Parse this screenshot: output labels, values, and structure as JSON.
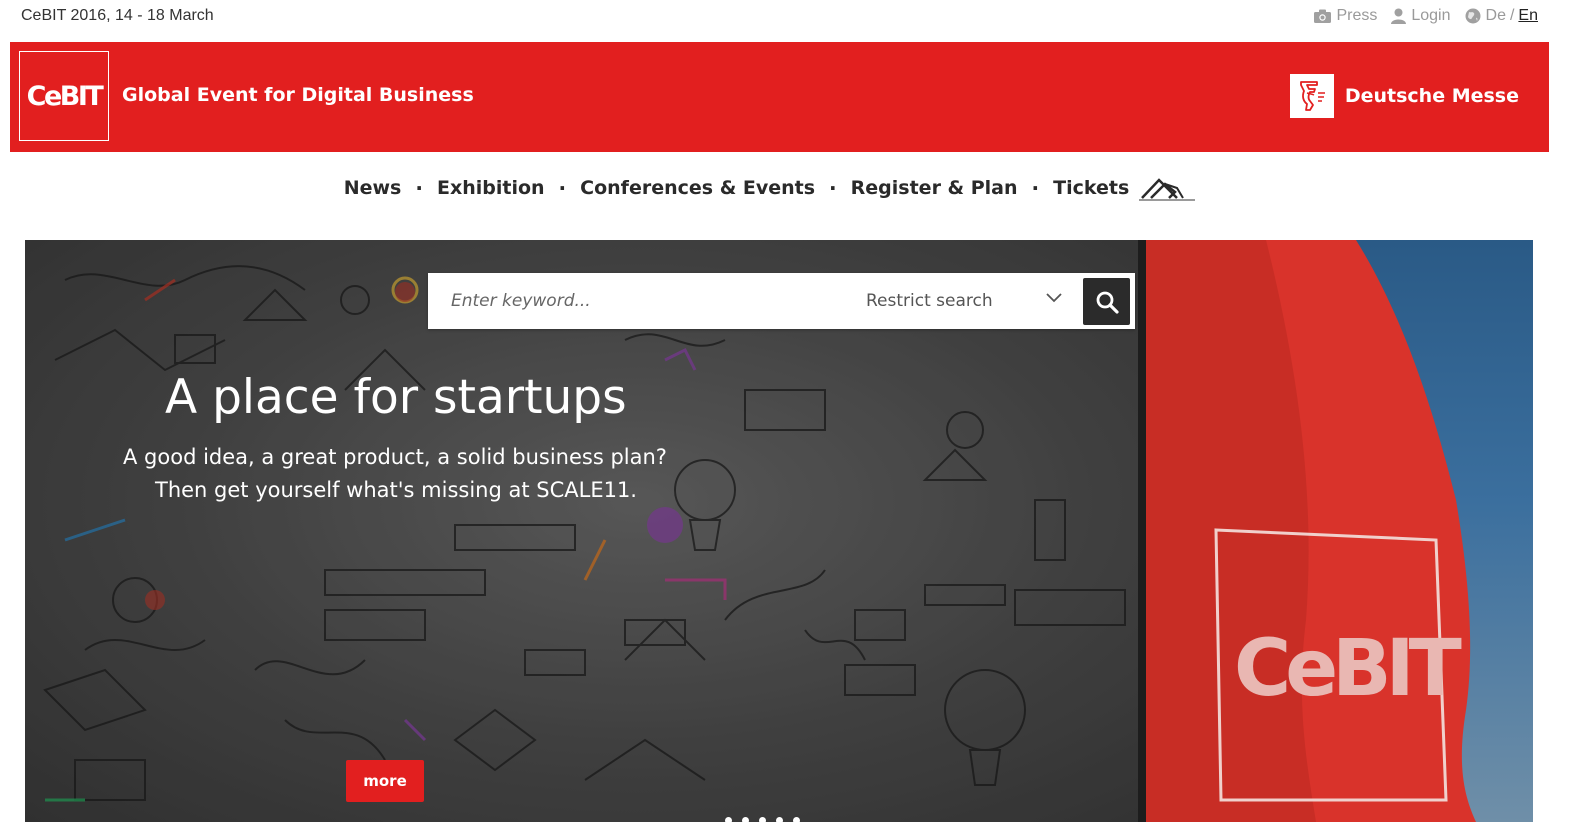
{
  "topbar": {
    "date": "CeBIT 2016, 14 - 18 March",
    "press_label": "Press",
    "login_label": "Login",
    "lang_de": "De",
    "lang_separator": "/",
    "lang_en": "En",
    "press_icon": "camera-icon",
    "login_icon": "user-icon",
    "lang_icon": "globe-icon"
  },
  "brand": {
    "logo_text": "CeBIT",
    "tagline": "Global Event for Digital Business",
    "partner_name": "Deutsche Messe",
    "partner_icon": "deutsche-messe-logo-icon",
    "brand_color": "#e21f1f"
  },
  "nav": {
    "items": [
      "News",
      "Exhibition",
      "Conferences & Events",
      "Register & Plan",
      "Tickets"
    ],
    "separator": "·",
    "ticket_icon": "ticket-icon"
  },
  "search": {
    "placeholder": "Enter keyword...",
    "restrict_label": "Restrict search",
    "button_icon": "search-icon"
  },
  "hero": {
    "title": "A place for startups",
    "subtitle_line1": "A good idea, a great product, a solid business plan?",
    "subtitle_line2": "Then get yourself what's missing at SCALE11.",
    "more_label": "more",
    "flag_text": "CeBIT"
  }
}
